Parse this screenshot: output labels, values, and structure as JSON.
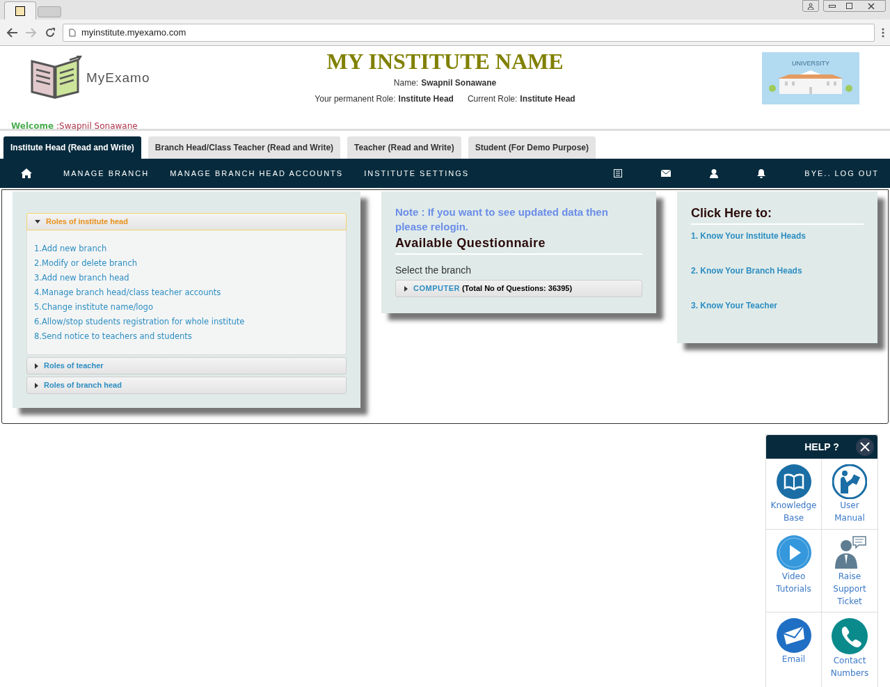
{
  "browser": {
    "tabs": [
      {
        "selected": true
      },
      {
        "selected": false
      }
    ],
    "url": "myinstitute.myexamo.com"
  },
  "header": {
    "logo_text": "MyExamo",
    "institute_name": "MY INSTITUTE NAME",
    "name_label": "Name:",
    "name_value": "Swapnil Sonawane",
    "permanent_role_label": "Your permanent Role:",
    "permanent_role_value": "Institute Head",
    "current_role_label": "Current Role:",
    "current_role_value": "Institute Head",
    "banner_text": "UNIVERSITY",
    "welcome_label": "Welcome",
    "welcome_name": ":Swapnil Sonawane"
  },
  "role_tabs": [
    {
      "label": "Institute Head (Read and Write)",
      "selected": true
    },
    {
      "label": "Branch Head/Class Teacher (Read and Write)",
      "selected": false
    },
    {
      "label": "Teacher (Read and Write)",
      "selected": false
    },
    {
      "label": "Student (For Demo Purpose)",
      "selected": false
    }
  ],
  "nav": {
    "links": [
      "MANAGE BRANCH",
      "MANAGE BRANCH HEAD ACCOUNTS",
      "INSTITUTE SETTINGS"
    ],
    "logout": "BYE.. LOG OUT"
  },
  "roles_accordion": [
    {
      "title": "Roles of institute head",
      "expanded": true,
      "items": [
        "1.Add new branch",
        "2.Modify or delete branch",
        "3.Add new branch head",
        "4.Manage branch head/class teacher accounts",
        "5.Change institute name/logo",
        "6.Allow/stop students registration for whole institute",
        "8.Send notice to teachers and students"
      ]
    },
    {
      "title": "Roles of teacher",
      "expanded": false
    },
    {
      "title": "Roles of branch head",
      "expanded": false
    }
  ],
  "questionnaire": {
    "note": "Note : If you want to see updated data then please relogin.",
    "title": "Available Questionnaire",
    "select_label": "Select the branch",
    "branches": [
      {
        "name": "COMPUTER",
        "detail": "(Total No of Questions: 36395)",
        "expanded": false
      }
    ]
  },
  "click_here": {
    "title": "Click Here to:",
    "links": [
      "1. Know Your Institute Heads",
      "2. Know Your Branch Heads",
      "3. Know Your Teacher"
    ]
  },
  "help": {
    "title": "HELP ?",
    "items": [
      {
        "label": "Knowledge Base"
      },
      {
        "label": "User Manual"
      },
      {
        "label": "Video Tutorials"
      },
      {
        "label": "Raise Support Ticket"
      },
      {
        "label": "Email"
      },
      {
        "label": "Contact Numbers"
      }
    ]
  }
}
